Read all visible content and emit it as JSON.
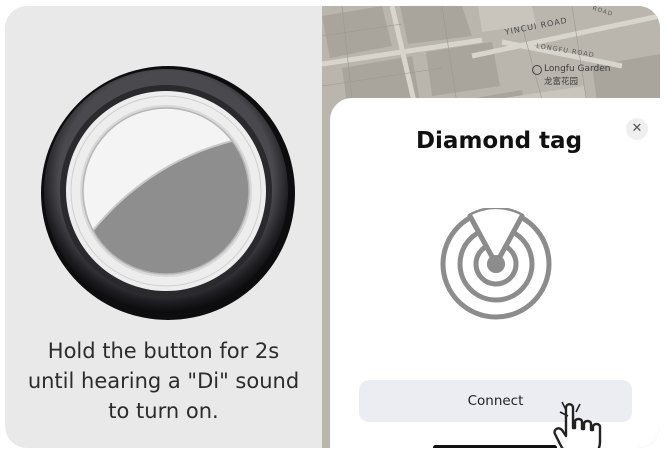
{
  "instruction": {
    "line1": "Hold the button for 2s",
    "line2": "until hearing a \"Di\" sound",
    "line3": "to turn on."
  },
  "map": {
    "road_main": "YINCUI ROAD",
    "road_side": "LONGFU ROAD",
    "road_top": "ROAD",
    "place_name_en": "Longfu Garden",
    "place_name_cn": "龙富花园"
  },
  "dialog": {
    "title": "Diamond tag",
    "close_glyph": "✕",
    "connect_label": "Connect",
    "icon": "radar-icon"
  },
  "colors": {
    "panel_left_bg": "#e9e9e9",
    "map_bg": "#b9b6ae",
    "button_bg": "#ececf3",
    "icon_gray": "#8a8a8a"
  }
}
